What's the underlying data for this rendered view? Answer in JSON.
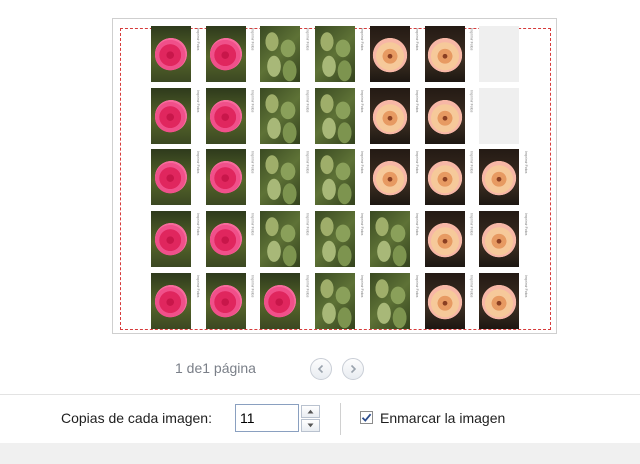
{
  "preview": {
    "photo_caption": "Imprimir Fotos",
    "grid": [
      [
        "rose-red",
        "rose-red",
        "leaves",
        "leaves",
        "rose-peach",
        "rose-peach",
        "blank"
      ],
      [
        "rose-red",
        "rose-red",
        "leaves",
        "leaves",
        "rose-peach",
        "rose-peach",
        "blank"
      ],
      [
        "rose-red",
        "rose-red",
        "leaves",
        "leaves",
        "rose-peach",
        "rose-peach",
        "rose-peach"
      ],
      [
        "rose-red",
        "rose-red",
        "leaves",
        "leaves",
        "leaves",
        "rose-peach",
        "rose-peach"
      ],
      [
        "rose-red",
        "rose-red",
        "rose-red",
        "leaves",
        "leaves",
        "rose-peach",
        "rose-peach"
      ]
    ],
    "margin_color": "#d63b3b"
  },
  "pager": {
    "text": "1 de1 página",
    "prev_icon": "chevron-left-icon",
    "next_icon": "chevron-right-icon"
  },
  "toolbar": {
    "copies_label": "Copias de cada imagen:",
    "copies_value": "11",
    "spinner_up_icon": "arrow-up-icon",
    "spinner_down_icon": "arrow-down-icon",
    "frame_checked": true,
    "frame_label": "Enmarcar la imagen"
  }
}
